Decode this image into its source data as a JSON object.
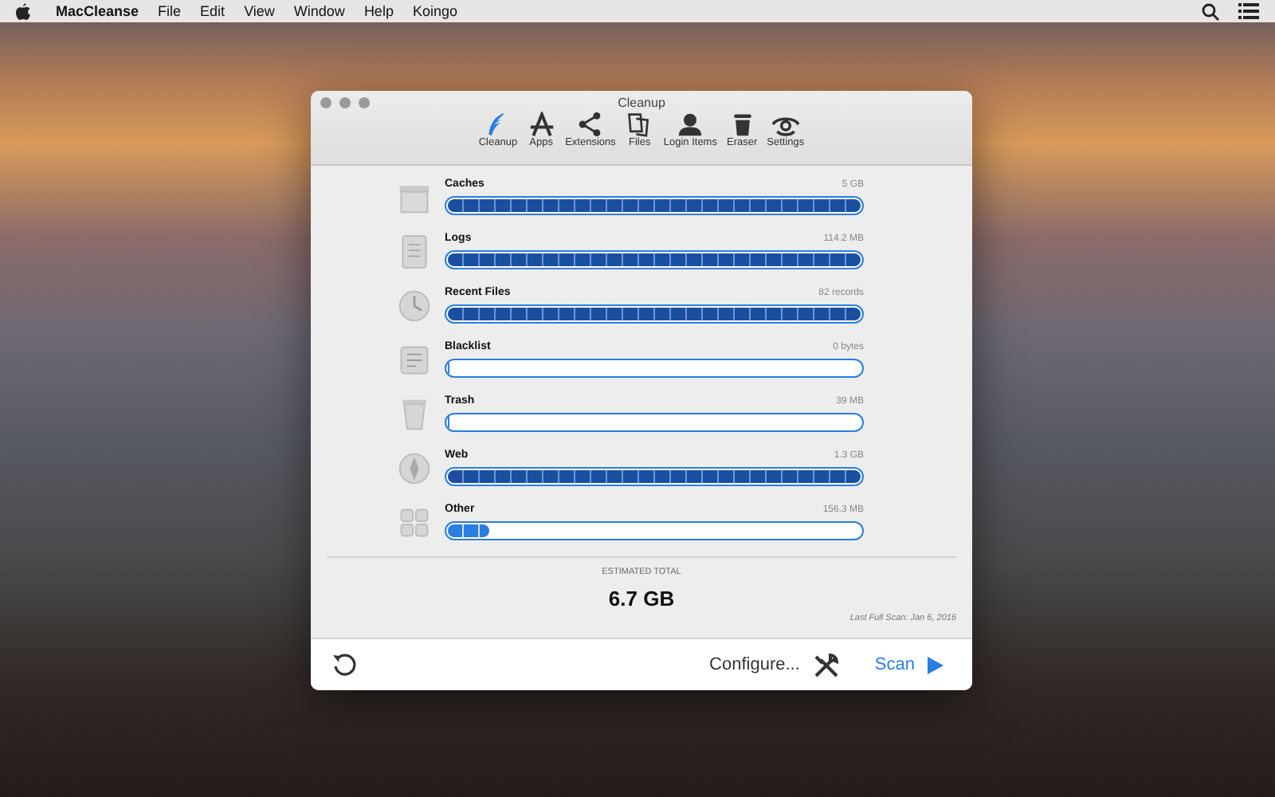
{
  "menu_bar": {
    "app_name": "MacCleanse",
    "items": [
      "File",
      "Edit",
      "View",
      "Window",
      "Help",
      "Koingo"
    ]
  },
  "window": {
    "title": "Cleanup"
  },
  "toolbar": [
    {
      "label": "Cleanup",
      "selected": true
    },
    {
      "label": "Apps",
      "selected": false
    },
    {
      "label": "Extensions",
      "selected": false
    },
    {
      "label": "Files",
      "selected": false
    },
    {
      "label": "Login Items",
      "selected": false
    },
    {
      "label": "Eraser",
      "selected": false
    },
    {
      "label": "Settings",
      "selected": false
    }
  ],
  "categories": [
    {
      "name": "Caches",
      "reading": "5 GB",
      "level": 1
    },
    {
      "name": "Logs",
      "reading": "114.2 MB",
      "level": 1
    },
    {
      "name": "Recent Files",
      "reading": "82 records",
      "level": 1
    },
    {
      "name": "Blacklist",
      "reading": "0 bytes",
      "level": 0
    },
    {
      "name": "Trash",
      "reading": "39 MB",
      "level": 0
    },
    {
      "name": "Web",
      "reading": "1.3 GB",
      "level": 1
    },
    {
      "name": "Other",
      "reading": "156.3 MB",
      "level": 0.1
    }
  ],
  "summary": {
    "label": "ESTIMATED TOTAL",
    "total": "6.7 GB",
    "last_scan": "Last Full Scan: Jan 6, 2016"
  },
  "footer": {
    "configure": "Configure...",
    "scan": "Scan"
  }
}
